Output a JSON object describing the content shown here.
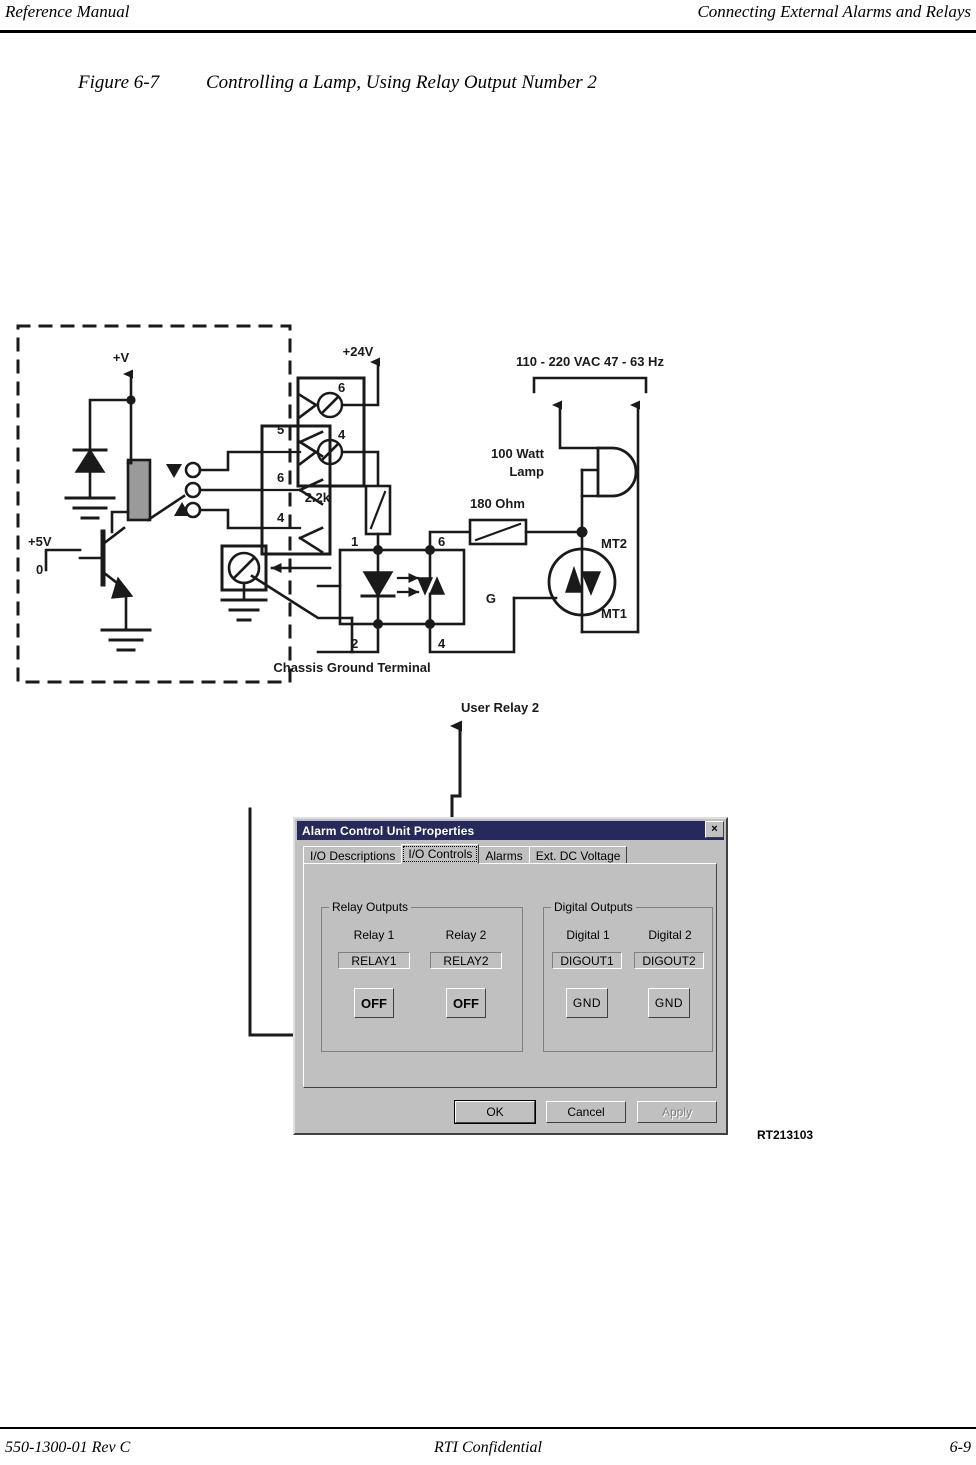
{
  "header": {
    "left": "Reference Manual",
    "right": "Connecting External Alarms and Relays"
  },
  "footer": {
    "left": "550-1300-01 Rev C",
    "center": "RTI Confidential",
    "right": "6-9"
  },
  "figure": {
    "number": "Figure 6-7",
    "title": "Controlling a Lamp, Using Relay Output Number 2",
    "drawing_number": "RT213103"
  },
  "schematic": {
    "labels": {
      "v_supply": "+V",
      "v_logic": "+5V",
      "logic_low": "0",
      "v24": "+24V",
      "ac_source": "110 - 220 VAC 47 - 63 Hz",
      "lamp": "100 Watt\nLamp",
      "lamp_line1": "100 Watt",
      "lamp_line2": "Lamp",
      "resistor_gate": "2.2k",
      "resistor_triac": "180 Ohm",
      "chassis_ground": "Chassis Ground Terminal",
      "user_relay": "User Relay 2",
      "mt1": "MT1",
      "mt2": "MT2",
      "gate": "G"
    },
    "relay_connector_pins": [
      "5",
      "6",
      "4"
    ],
    "terminal_block_pins": [
      "6",
      "4"
    ],
    "optocoupler_pins": {
      "in_top": "1",
      "in_bottom": "2",
      "out_top": "6",
      "out_bottom": "4"
    }
  },
  "dialog": {
    "title": "Alarm Control Unit Properties",
    "close_label": "×",
    "tabs": [
      {
        "label": "I/O Descriptions",
        "active": false
      },
      {
        "label": "I/O Controls",
        "active": true
      },
      {
        "label": "Alarms",
        "active": false
      },
      {
        "label": "Ext. DC Voltage",
        "active": false
      }
    ],
    "relay_group": {
      "legend": "Relay Outputs",
      "columns": [
        {
          "header": "Relay 1",
          "name": "RELAY1",
          "state": "OFF"
        },
        {
          "header": "Relay 2",
          "name": "RELAY2",
          "state": "OFF"
        }
      ]
    },
    "digital_group": {
      "legend": "Digital Outputs",
      "columns": [
        {
          "header": "Digital 1",
          "name": "DIGOUT1",
          "state": "GND"
        },
        {
          "header": "Digital 2",
          "name": "DIGOUT2",
          "state": "GND"
        }
      ]
    },
    "buttons": [
      {
        "label": "OK",
        "state": "default"
      },
      {
        "label": "Cancel",
        "state": "normal"
      },
      {
        "label": "Apply",
        "state": "disabled"
      }
    ]
  },
  "colors": {
    "titlebar": "#26295c",
    "dialog_face": "#c0c0c0",
    "ink": "#000000",
    "coil_fill": "#9a9a9a"
  }
}
